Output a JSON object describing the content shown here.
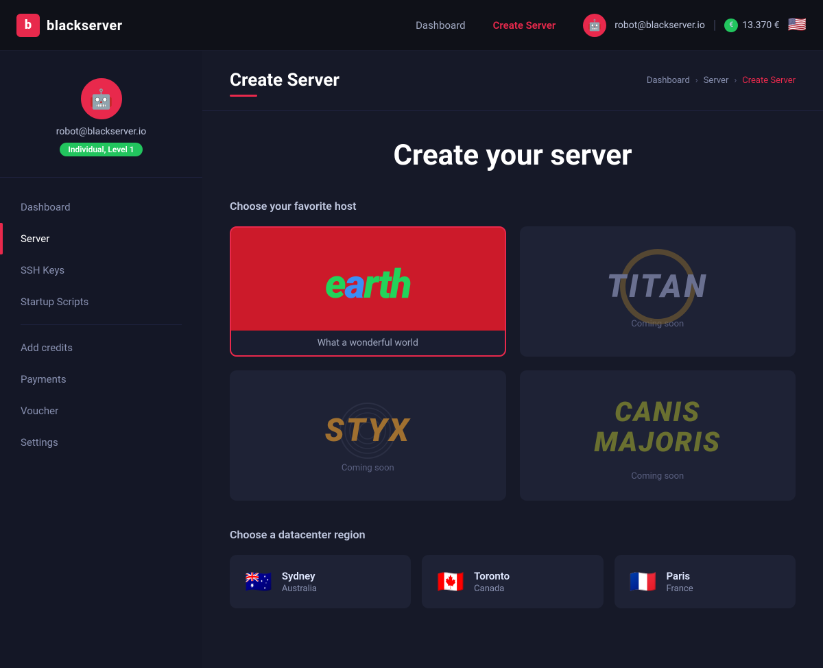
{
  "topnav": {
    "logo_icon": "b",
    "logo_text": "blackserver",
    "nav_links": [
      {
        "label": "Dashboard",
        "active": false
      },
      {
        "label": "Create Server",
        "active": true
      }
    ],
    "user_email": "robot@blackserver.io",
    "credits_amount": "13.370 €",
    "flag": "🇺🇸"
  },
  "sidebar": {
    "profile": {
      "email": "robot@blackserver.io",
      "badge": "Individual, Level 1"
    },
    "nav_items": [
      {
        "label": "Dashboard",
        "active": false
      },
      {
        "label": "Server",
        "active": true
      },
      {
        "label": "SSH Keys",
        "active": false
      },
      {
        "label": "Startup Scripts",
        "active": false
      },
      {
        "label": "Add credits",
        "active": false
      },
      {
        "label": "Payments",
        "active": false
      },
      {
        "label": "Voucher",
        "active": false
      },
      {
        "label": "Settings",
        "active": false
      }
    ]
  },
  "main": {
    "title": "Create Server",
    "breadcrumb": {
      "dashboard": "Dashboard",
      "server": "Server",
      "current": "Create Server"
    },
    "page_heading": "Create your server",
    "hosts_section_label": "Choose your favorite host",
    "hosts": [
      {
        "id": "earth",
        "name": "earth",
        "caption": "What a wonderful world",
        "status": "active",
        "coming_soon": false
      },
      {
        "id": "titan",
        "name": "TITAN",
        "status": "coming_soon",
        "coming_soon": true,
        "coming_soon_label": "Coming soon"
      },
      {
        "id": "styx",
        "name": "STYX",
        "status": "coming_soon",
        "coming_soon": true,
        "coming_soon_label": "Coming soon"
      },
      {
        "id": "canis-majoris",
        "name": "CANIS MAJORIS",
        "status": "coming_soon",
        "coming_soon": true,
        "coming_soon_label": "Coming soon"
      }
    ],
    "datacenter_section_label": "Choose a datacenter region",
    "datacenters": [
      {
        "flag": "🇦🇺",
        "city": "Sydney",
        "country": "Australia"
      },
      {
        "flag": "🇨🇦",
        "city": "Toronto",
        "country": "Canada"
      },
      {
        "flag": "🇫🇷",
        "city": "Paris",
        "country": "France"
      }
    ]
  }
}
